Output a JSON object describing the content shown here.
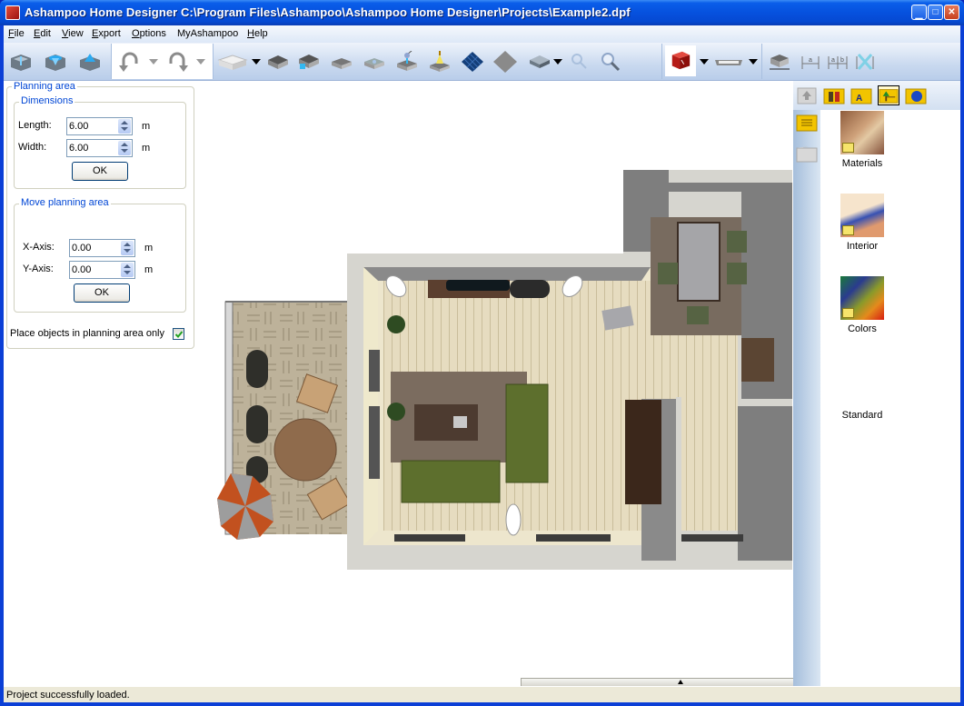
{
  "window": {
    "title": "Ashampoo Home Designer C:\\Program Files\\Ashampoo\\Ashampoo Home Designer\\Projects\\Example2.dpf",
    "controls": {
      "minimize": "_",
      "maximize": "□",
      "close": "✕"
    }
  },
  "menu": {
    "items": [
      {
        "label": "File",
        "accel": "F"
      },
      {
        "label": "Edit",
        "accel": "E"
      },
      {
        "label": "View",
        "accel": "V"
      },
      {
        "label": "Export",
        "accel": "E"
      },
      {
        "label": "Options",
        "accel": "O"
      },
      {
        "label": "MyAshampoo",
        "accel": ""
      },
      {
        "label": "Help",
        "accel": "H"
      }
    ]
  },
  "toolbar": {
    "icons": [
      "view-2d-icon",
      "view-3d-icon",
      "view-3d-light-icon",
      "undo-icon",
      "redo-icon",
      "room-icon",
      "wall-icon",
      "wall-window-icon",
      "floor-icon",
      "floor-2-icon",
      "lamp-ceiling-icon",
      "light-icon",
      "solar-panel-icon",
      "tile-icon",
      "slab-icon",
      "zoom-out-icon",
      "zoom-in-icon",
      "material-cube-icon",
      "stairs-icon",
      "furniture-lift-icon",
      "dimension-a-icon",
      "dimension-ab-icon",
      "dimension-clear-icon"
    ]
  },
  "planning_area": {
    "legend": "Planning area",
    "dimensions": {
      "legend": "Dimensions",
      "length_label": "Length:",
      "length_value": "6.00",
      "width_label": "Width:",
      "width_value": "6.00",
      "unit": "m",
      "ok_label": "OK"
    },
    "move": {
      "legend": "Move planning area",
      "x_label": "X-Axis:",
      "x_value": "0.00",
      "y_label": "Y-Axis:",
      "y_value": "0.00",
      "unit": "m",
      "ok_label": "OK"
    },
    "place_only_label": "Place objects in planning area only",
    "place_only_checked": true
  },
  "library": {
    "tabs": [
      "up-folder-icon",
      "furniture-folder-icon",
      "text-folder-icon",
      "plants-folder-icon",
      "globe-folder-icon"
    ],
    "selected_tab": 3,
    "side_tabs": [
      "catalog-folder-icon",
      "open-folder-icon"
    ],
    "items": [
      {
        "label": "Materials"
      },
      {
        "label": "Interior"
      },
      {
        "label": "Colors"
      },
      {
        "label": "Standard"
      }
    ]
  },
  "status": {
    "text": "Project successfully loaded."
  }
}
